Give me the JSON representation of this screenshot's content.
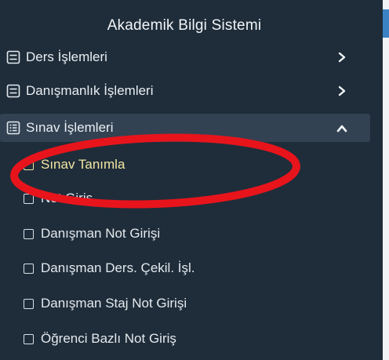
{
  "sidebar": {
    "title": "Akademik Bilgi Sistemi",
    "menus": [
      {
        "label": "Ders İşlemleri",
        "icon": "list-icon",
        "expanded": false
      },
      {
        "label": "Danışmanlık İşlemleri",
        "icon": "list-icon",
        "expanded": false
      },
      {
        "label": "Sınav İşlemleri",
        "icon": "list-icon",
        "expanded": true
      }
    ],
    "submenu": [
      {
        "label": "Sınav Tanımla",
        "selected": true
      },
      {
        "label": "Not Giriş"
      },
      {
        "label": "Danışman Not Girişi"
      },
      {
        "label": "Danışman Ders. Çekil. İşl."
      },
      {
        "label": "Danışman Staj Not Girişi"
      },
      {
        "label": "Öğrenci Bazlı Not Giriş"
      }
    ]
  },
  "colors": {
    "background": "#1f2d3a",
    "active_menu": "#324252",
    "selected_text": "#f3e6a2",
    "annotation_circle": "#e8141c"
  }
}
